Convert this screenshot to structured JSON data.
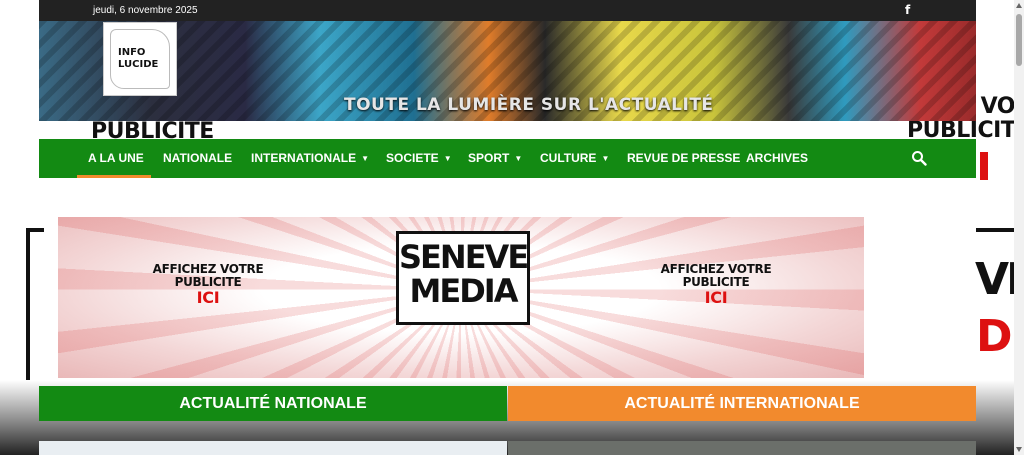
{
  "topbar": {
    "date": "jeudi, 6 novembre 2025",
    "facebook_icon": "f"
  },
  "header": {
    "logo_text_1": "INFO",
    "logo_text_2": "LUCIDE",
    "tagline": "TOUTE LA LUMIÈRE SUR L'ACTUALITÉ",
    "pub_left": "PUBLICITE"
  },
  "wallpaper": {
    "right_top": "Z VO",
    "right_pub": "PUBLICITE",
    "right_big_1": "VI",
    "right_big_2": "D"
  },
  "nav": {
    "items": [
      {
        "label": "A LA UNE",
        "dropdown": false,
        "active": true
      },
      {
        "label": "NATIONALE",
        "dropdown": false
      },
      {
        "label": "INTERNATIONALE",
        "dropdown": true
      },
      {
        "label": "SOCIETE",
        "dropdown": true
      },
      {
        "label": "SPORT",
        "dropdown": true
      },
      {
        "label": "CULTURE",
        "dropdown": true
      },
      {
        "label": "REVUE DE PRESSE",
        "dropdown": false
      },
      {
        "label": "ARCHIVES",
        "dropdown": false
      }
    ],
    "chevron": "▼",
    "active_color": "#f28a2d",
    "bar_color": "#138a13"
  },
  "ad": {
    "left_line_1": "AFFICHEZ VOTRE",
    "left_line_2": "PUBLICITE",
    "left_ici": "ICI",
    "right_line_1": "AFFICHEZ VOTRE",
    "right_line_2": "PUBLICITE",
    "right_ici": "ICI",
    "brand_line_1": "SENEVE",
    "brand_line_2": "MEDIA"
  },
  "sections": {
    "national": "ACTUALITÉ NATIONALE",
    "international": "ACTUALITÉ INTERNATIONALE",
    "national_color": "#138a13",
    "international_color": "#f28a2d"
  }
}
